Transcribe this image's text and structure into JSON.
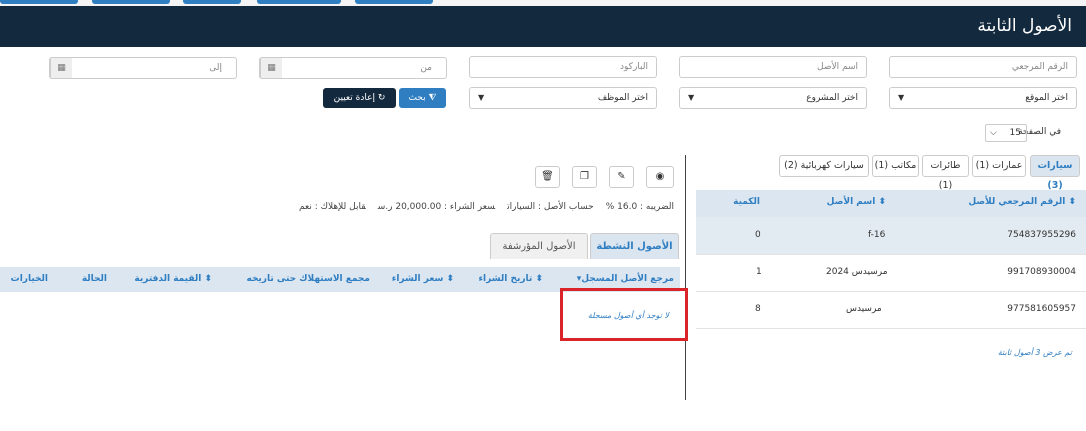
{
  "page": {
    "title": "الأصول الثابتة"
  },
  "filters": {
    "reference_placeholder": "الرقم المرجعي",
    "asset_name_placeholder": "اسم الأصل",
    "barcode_placeholder": "الباركود",
    "from_placeholder": "من",
    "to_placeholder": "إلى",
    "location_select": "اختر الموقع",
    "project_select": "اختر المشروع",
    "employee_select": "اختر الموظف",
    "search_label": "بحث",
    "reset_label": "إعادة تعيين"
  },
  "pagination": {
    "per_page_label": "في الصفحة",
    "per_page_value": "15"
  },
  "categories": [
    {
      "label": "سيارات (3)",
      "active": true
    },
    {
      "label": "عمارات (1)"
    },
    {
      "label": "طائرات (1)"
    },
    {
      "label": "مكاتب (1)"
    },
    {
      "label": "سيارات كهربائية (2)"
    }
  ],
  "asset_table": {
    "headers": {
      "reference": "الرقم المرجعي للأصل",
      "name": "اسم الأصل",
      "quantity": "الكمية"
    },
    "rows": [
      {
        "reference": "754837955296",
        "name": "f-16",
        "quantity": "0"
      },
      {
        "reference": "991708930004",
        "name": "مرسيدس 2024",
        "quantity": "1"
      },
      {
        "reference": "977581605957",
        "name": "مرسيدس",
        "quantity": "8"
      }
    ],
    "footer": "تم عرض 3 أصول ثابتة"
  },
  "detail": {
    "info": {
      "tax": "الضريبه : 16.0 %",
      "account": "حساب الأصل : السيارات",
      "price": "سعر الشراء : 20,000.00 ر.س",
      "depreciable": "قابل للإهلاك : نعم"
    },
    "tabs": {
      "active": "الأصول النشطة",
      "archived": "الأصول المؤرشفة"
    },
    "headers": {
      "ref": "مرجع الأصل المسجل",
      "purchase_date": "تاريخ الشراء",
      "purchase_price": "سعر الشراء",
      "accumulated": "مجمع الاستهلاك حتى تاريخه",
      "book_value": "القيمة الدفترية",
      "status": "الحالة",
      "options": "الخيارات"
    },
    "empty_message": "لا توجد أي أصول مسجلة"
  },
  "icons": {
    "eye": "eye-icon",
    "edit": "edit-icon",
    "copy": "copy-icon",
    "trash": "trash-icon",
    "calendar": "calendar-icon",
    "filter": "filter-icon",
    "reset": "reset-icon",
    "sort": "sort-icon",
    "caret": "caret-down-icon"
  },
  "colors": {
    "header_bg": "#132a3e",
    "accent": "#2f7ec2",
    "highlight": "#d9242a"
  }
}
